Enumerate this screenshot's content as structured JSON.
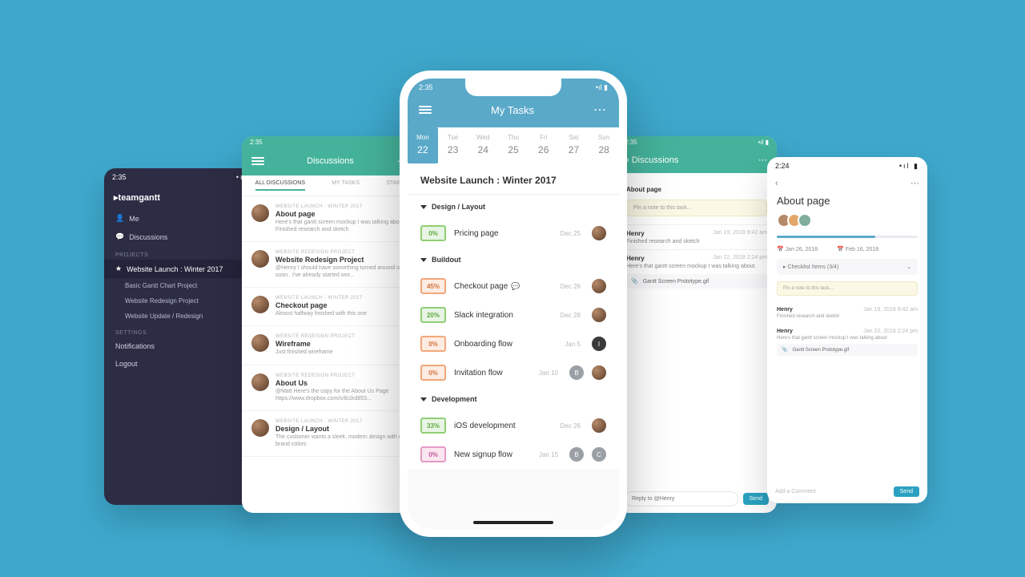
{
  "sidebar": {
    "brand": "teamgantt",
    "nav": {
      "me": "Me",
      "discussions": "Discussions"
    },
    "sections": {
      "projects": "PROJECTS",
      "settings": "SETTINGS"
    },
    "active_project": "Website Launch : Winter 2017",
    "projects": [
      "Basic Gantt Chart Project",
      "Website Redesign Project",
      "Website Update / Redesign"
    ],
    "settings": {
      "notifications": "Notifications",
      "logout": "Logout"
    },
    "time": "2:35"
  },
  "discussions": {
    "time": "2:35",
    "title": "Discussions",
    "tabs": [
      "ALL DISCUSSIONS",
      "MY TASKS",
      "STARRED"
    ],
    "items": [
      {
        "project": "WEBSITE LAUNCH - WINTER 2017",
        "title": "About page",
        "snippet": "Here's that gantt screen mockup I was talking about.. Finished research and sketch"
      },
      {
        "project": "WEBSITE REDESIGN PROJECT",
        "title": "Website Redesign Project",
        "snippet": "@Henry I should have something turned around on this soon.. I've already started wor..."
      },
      {
        "project": "WEBSITE LAUNCH - WINTER 2017",
        "title": "Checkout page",
        "snippet": "Almost halfway finished with this one"
      },
      {
        "project": "WEBSITE REDESIGN PROJECT",
        "title": "Wireframe",
        "snippet": "Just finished wireframe"
      },
      {
        "project": "WEBSITE REDESIGN PROJECT",
        "title": "About Us",
        "snippet": "@Matt Here's the copy for the About Us Page https://www.dropbox.com/s/ib1kd853..."
      },
      {
        "project": "WEBSITE LAUNCH - WINTER 2017",
        "title": "Design / Layout",
        "snippet": "The customer wants a sleek, modern design with our brand colors"
      }
    ]
  },
  "taskdetail": {
    "time": "2:35",
    "back": "Discussions",
    "title": "About page",
    "note_placeholder": "Pin a note to this task...",
    "comments": [
      {
        "name": "Henry",
        "date": "Jan 19, 2018 9:42 am",
        "msg": "Finished research and sketch"
      },
      {
        "name": "Henry",
        "date": "Jan 22, 2018 2:24 pm",
        "msg": "Here's that gantt screen mockup I was talking about.",
        "attachment": "Gantt Screen Prototype.gif"
      }
    ],
    "reply_placeholder": "Reply to @Henry",
    "send": "Send"
  },
  "about": {
    "time": "2:24",
    "title": "About page",
    "date_start": "Jan 26, 2018",
    "date_end": "Feb 16, 2018",
    "checklist_label": "Checklist Items",
    "checklist_count": "(3/4)",
    "note_placeholder": "Pin a note to this task...",
    "comments": [
      {
        "name": "Henry",
        "date": "Jan 19, 2018 9:42 am",
        "msg": "Finished research and sketch"
      },
      {
        "name": "Henry",
        "date": "Jan 22, 2018 2:24 pm",
        "msg": "Here's that gantt screen mockup I was talking about",
        "attachment": "Gantt Screen Prototype.gif"
      }
    ],
    "add_comment": "Add a Comment",
    "send": "Send"
  },
  "main": {
    "time": "2:35",
    "title": "My Tasks",
    "week": [
      {
        "lab": "Mon",
        "num": "22",
        "active": true
      },
      {
        "lab": "Tue",
        "num": "23"
      },
      {
        "lab": "Wed",
        "num": "24"
      },
      {
        "lab": "Thu",
        "num": "25"
      },
      {
        "lab": "Fri",
        "num": "26"
      },
      {
        "lab": "Sat",
        "num": "27"
      },
      {
        "lab": "Sun",
        "num": "28"
      }
    ],
    "project_title": "Website Launch : Winter 2017",
    "groups": [
      {
        "name": "Design / Layout",
        "tasks": [
          {
            "pct": "0%",
            "cls": "green",
            "name": "Pricing page",
            "date": "Dec 25",
            "avatar": "photo"
          }
        ]
      },
      {
        "name": "Buildout",
        "tasks": [
          {
            "pct": "45%",
            "cls": "orange",
            "name": "Checkout page",
            "date": "Dec 26",
            "avatar": "photo",
            "icon": "comment"
          },
          {
            "pct": "20%",
            "cls": "green",
            "name": "Slack integration",
            "date": "Dec 28",
            "avatar": "photo"
          },
          {
            "pct": "0%",
            "cls": "orange0",
            "name": "Onboarding flow",
            "date": "Jan 5",
            "avatar": "I"
          },
          {
            "pct": "0%",
            "cls": "orange0",
            "name": "Invitation flow",
            "date": "Jan 10",
            "avatar": "B",
            "avatar2": "photo"
          }
        ]
      },
      {
        "name": "Development",
        "tasks": [
          {
            "pct": "33%",
            "cls": "green",
            "name": "iOS development",
            "date": "Dec 26",
            "avatar": "photo"
          },
          {
            "pct": "0%",
            "cls": "pink",
            "name": "New signup flow",
            "date": "Jan 15",
            "avatar": "B",
            "avatar2": "C"
          }
        ]
      }
    ]
  }
}
